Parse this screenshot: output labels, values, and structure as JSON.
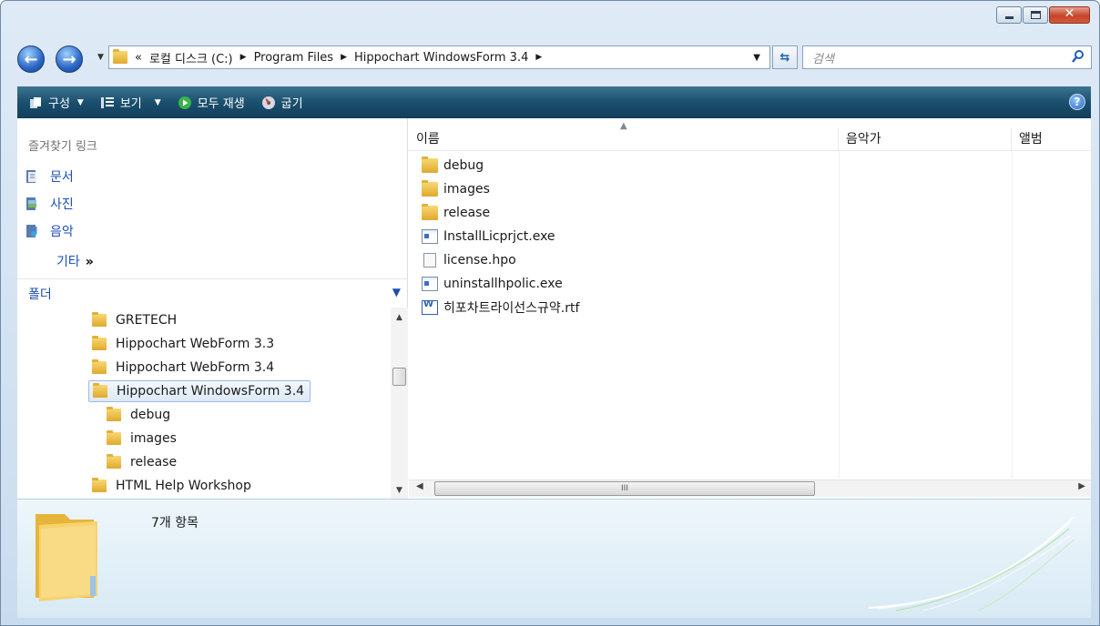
{
  "address": {
    "prefix": "«",
    "crumbs": [
      "로컬 디스크 (C:)",
      "Program Files",
      "Hippochart WindowsForm 3.4"
    ]
  },
  "search": {
    "placeholder": "검색"
  },
  "toolbar": {
    "organize": "구성",
    "views": "보기",
    "play_all": "모두 재생",
    "burn": "굽기"
  },
  "nav": {
    "favorites_title": "즐겨찾기 링크",
    "favorites": [
      "문서",
      "사진",
      "음악"
    ],
    "more": "기타",
    "more_chevron": "»",
    "folders_label": "폴더"
  },
  "tree": [
    "GRETECH",
    "Hippochart WebForm 3.3",
    "Hippochart WebForm 3.4",
    "Hippochart WindowsForm 3.4",
    "debug",
    "images",
    "release",
    "HTML Help Workshop"
  ],
  "columns": [
    "이름",
    "음악가",
    "앨범"
  ],
  "files": [
    {
      "name": "debug",
      "type": "folder"
    },
    {
      "name": "images",
      "type": "folder"
    },
    {
      "name": "release",
      "type": "folder"
    },
    {
      "name": "InstallLicprjct.exe",
      "type": "exe"
    },
    {
      "name": "license.hpo",
      "type": "doc"
    },
    {
      "name": "uninstallhpolic.exe",
      "type": "exe"
    },
    {
      "name": "히포차트라이선스규약.rtf",
      "type": "rtf"
    }
  ],
  "details": {
    "item_count": "7개 항목"
  },
  "scroll": {
    "h_thumb_mark": "III"
  }
}
